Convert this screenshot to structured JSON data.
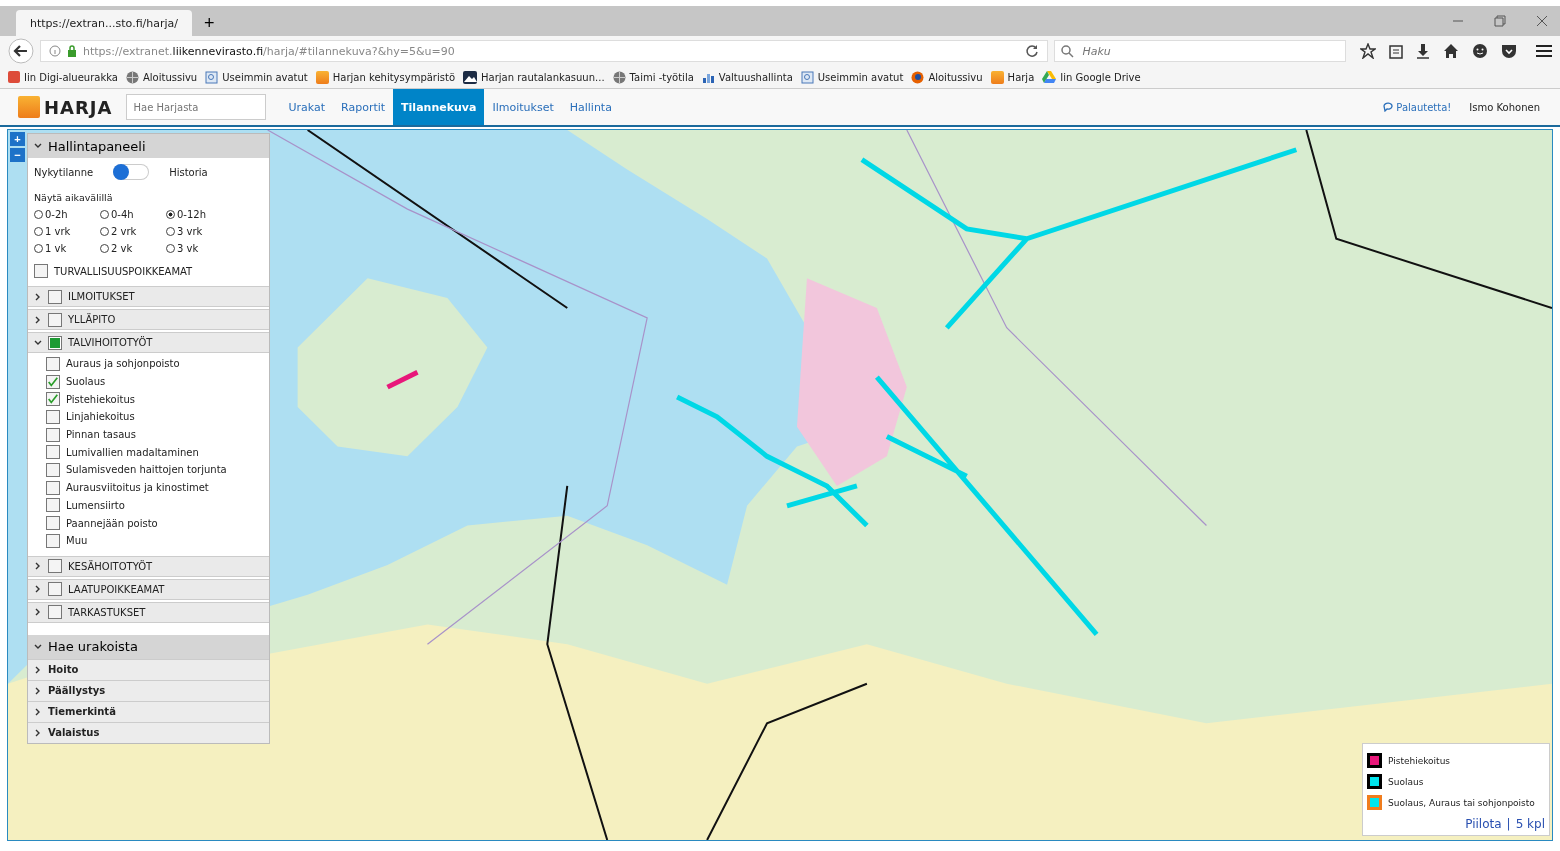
{
  "browser": {
    "tab_title": "https://extran...sto.fi/harja/",
    "new_tab": "+",
    "url_prefix": "https://extranet.",
    "url_domain": "liikennevirasto.fi",
    "url_path": "/harja/#tilannekuva?&hy=5&u=90",
    "search_placeholder": "Haku"
  },
  "bookmarks": [
    {
      "kind": "gplus",
      "label": "Iin Digi-alueurakka"
    },
    {
      "kind": "globe",
      "label": "Aloitussivu"
    },
    {
      "kind": "doc",
      "label": "Useimmin avatut"
    },
    {
      "kind": "harja",
      "label": "Harjan kehitysympäristö"
    },
    {
      "kind": "mountain",
      "label": "Harjan rautalankasuun..."
    },
    {
      "kind": "globe",
      "label": "Taimi -työtila"
    },
    {
      "kind": "chart",
      "label": "Valtuushallinta"
    },
    {
      "kind": "doc",
      "label": "Useimmin avatut"
    },
    {
      "kind": "firefox",
      "label": "Aloitussivu"
    },
    {
      "kind": "harja",
      "label": "Harja"
    },
    {
      "kind": "drive",
      "label": "Iin Google Drive"
    }
  ],
  "app": {
    "logo": "HARJA",
    "search_placeholder": "Hae Harjasta",
    "feedback": "Palautetta!",
    "user": "Ismo Kohonen"
  },
  "nav": [
    {
      "label": "Urakat",
      "selected": false
    },
    {
      "label": "Raportit",
      "selected": false
    },
    {
      "label": "Tilannekuva",
      "selected": true
    },
    {
      "label": "Ilmoitukset",
      "selected": false
    },
    {
      "label": "Hallinta",
      "selected": false
    }
  ],
  "zoom": {
    "in": "+",
    "out": "−"
  },
  "panel": {
    "title": "Hallintapaneeli",
    "expanded": true,
    "toggle_left": "Nykytilanne",
    "toggle_right": "Historia",
    "history_on": false,
    "interval_label": "Näytä aikavälillä",
    "intervals": [
      {
        "label": "0-2h",
        "selected": false
      },
      {
        "label": "0-4h",
        "selected": false
      },
      {
        "label": "0-12h",
        "selected": true
      },
      {
        "label": "1 vrk",
        "selected": false
      },
      {
        "label": "2 vrk",
        "selected": false
      },
      {
        "label": "3 vrk",
        "selected": false
      },
      {
        "label": "1 vk",
        "selected": false
      },
      {
        "label": "2 vk",
        "selected": false
      },
      {
        "label": "3 vk",
        "selected": false
      }
    ],
    "safety": {
      "label": "TURVALLISUUSPOIKKEAMAT",
      "checked": false
    },
    "groups": [
      {
        "label": "ILMOITUKSET",
        "checked": false,
        "expanded": false
      },
      {
        "label": "YLLÄPITO",
        "checked": false,
        "expanded": false
      },
      {
        "label": "TALVIHOITOTYÖT",
        "checked": true,
        "expanded": true,
        "items": [
          {
            "label": "Auraus ja sohjonpoisto",
            "checked": false
          },
          {
            "label": "Suolaus",
            "checked": true
          },
          {
            "label": "Pistehiekoitus",
            "checked": true
          },
          {
            "label": "Linjahiekoitus",
            "checked": false
          },
          {
            "label": "Pinnan tasaus",
            "checked": false
          },
          {
            "label": "Lumivallien madaltaminen",
            "checked": false
          },
          {
            "label": "Sulamisveden haittojen torjunta",
            "checked": false
          },
          {
            "label": "Aurausviitoitus ja kinostimet",
            "checked": false
          },
          {
            "label": "Lumensiirto",
            "checked": false
          },
          {
            "label": "Paannejään poisto",
            "checked": false
          },
          {
            "label": "Muu",
            "checked": false
          }
        ]
      },
      {
        "label": "KESÄHOITOTYÖT",
        "checked": false,
        "expanded": false
      },
      {
        "label": "LAATUPOIKKEAMAT",
        "checked": false,
        "expanded": false
      },
      {
        "label": "TARKASTUKSET",
        "checked": false,
        "expanded": false
      }
    ]
  },
  "contracts": {
    "title": "Hae urakoista",
    "expanded": true,
    "items": [
      {
        "label": "Hoito",
        "expanded": false
      },
      {
        "label": "Päällystys",
        "expanded": false
      },
      {
        "label": "Tiemerkintä",
        "expanded": false
      },
      {
        "label": "Valaistus",
        "expanded": false
      }
    ]
  },
  "legend": {
    "items": [
      {
        "label": "Pistehiekoitus",
        "color": "#e8177a",
        "kind": "plain"
      },
      {
        "label": "Suolaus",
        "color": "#00e5ee",
        "kind": "plain"
      },
      {
        "label": "Suolaus, Auraus tai sohjonpoisto",
        "color": "#00e5ee",
        "kind": "framed"
      }
    ],
    "hide": "Piilota",
    "separator": "|",
    "count": "5 kpl"
  }
}
